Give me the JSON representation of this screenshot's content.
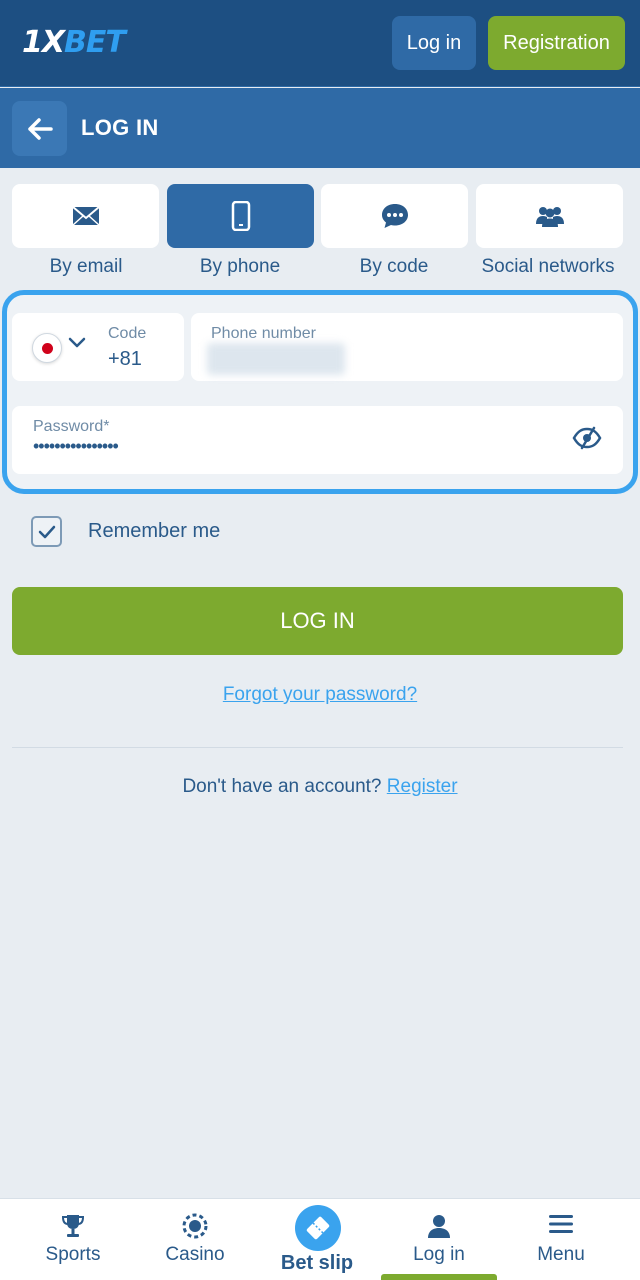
{
  "header": {
    "logo_part1": "1X",
    "logo_part2": "BET",
    "login_label": "Log in",
    "register_label": "Registration"
  },
  "titlebar": {
    "title": "LOG IN",
    "back_icon": "arrow-left-icon"
  },
  "methods": [
    {
      "label": "By email",
      "icon": "envelope-icon",
      "active": false
    },
    {
      "label": "By phone",
      "icon": "smartphone-icon",
      "active": true
    },
    {
      "label": "By code",
      "icon": "chat-bubble-icon",
      "active": false
    },
    {
      "label": "Social networks",
      "icon": "users-icon",
      "active": false
    }
  ],
  "form": {
    "code_label": "Code",
    "code_value": "+81",
    "country_flag": "japan-flag",
    "phone_label": "Phone number",
    "password_label": "Password*",
    "password_value": "••••••••••••••••"
  },
  "remember": {
    "label": "Remember me",
    "checked": true
  },
  "actions": {
    "login_label": "LOG IN",
    "forgot_label": "Forgot your password?",
    "no_account_text": "Don't have an account?",
    "register_link": "Register"
  },
  "bottom_nav": [
    {
      "label": "Sports",
      "icon": "trophy-icon"
    },
    {
      "label": "Casino",
      "icon": "casino-chip-icon"
    },
    {
      "label": "Bet slip",
      "icon": "ticket-icon"
    },
    {
      "label": "Log in",
      "icon": "user-icon",
      "active": true
    },
    {
      "label": "Menu",
      "icon": "hamburger-menu-icon"
    }
  ],
  "colors": {
    "header_bg": "#1d4f82",
    "titlebar_bg": "#2f6aa6",
    "accent_green": "#7daa2f",
    "accent_blue": "#3aa3ee",
    "page_bg": "#e8edf2"
  }
}
